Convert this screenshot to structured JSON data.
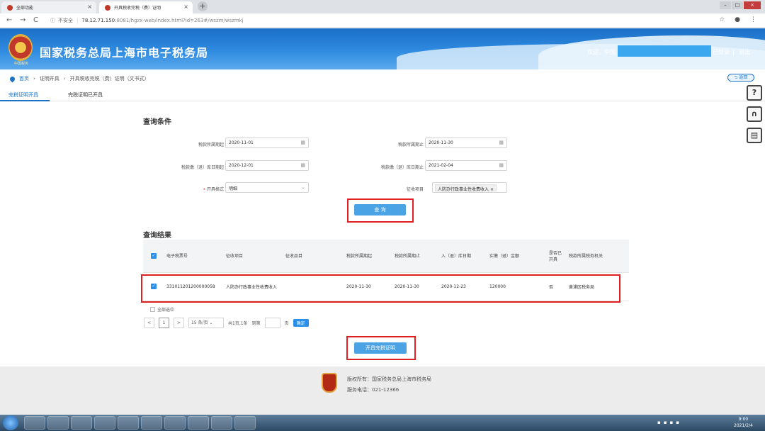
{
  "browser": {
    "tabs": [
      {
        "label": "全部功能",
        "close": "×"
      },
      {
        "label": "开具税收完税（费）证明",
        "close": "×"
      }
    ],
    "new_tab": "+",
    "not_secure": "不安全",
    "url_host": "78.12.71.150",
    "url_rest": ":8081/hgzx-web/index.html?id=263#/wszm/wszmkj",
    "star": "☆",
    "menu": "⋮"
  },
  "header": {
    "emblem_text": "中国税务",
    "site_title": "国家税务总局上海市电子税务局",
    "welcome": "欢迎，中国",
    "user_suffix": "已登录",
    "logout": "退出"
  },
  "breadcrumb": {
    "items": [
      "首页",
      "证明开具",
      "开具税收完税（费）证明（文书式）"
    ],
    "back": "返回"
  },
  "subtabs": [
    "完税证明开具",
    "完税证明已开具"
  ],
  "query": {
    "title": "查询条件",
    "fields": {
      "period_start_label": "税款所属期起",
      "period_start_value": "2020-11-01",
      "period_end_label": "税款所属期止",
      "period_end_value": "2020-11-30",
      "stock_start_label": "税款缴（退）库日期起",
      "stock_start_value": "2020-12-01",
      "stock_end_label": "税款缴（退）库日期止",
      "stock_end_value": "2021-02-04",
      "format_label": "开具格式",
      "format_value": "明细",
      "item_label": "征收项目",
      "item_value": "人防办行政事业性收费收入"
    },
    "button": "查 询"
  },
  "results": {
    "title": "查询结果",
    "headers": [
      "电子税票号",
      "征收项目",
      "征收品目",
      "税款所属期起",
      "税款所属期止",
      "入（退）库日期",
      "实缴（退）金额",
      "是否已开具",
      "税款所属税务机关"
    ],
    "rows": [
      {
        "ticket": "331011201200000058",
        "item": "人防办行政事业性收费收入",
        "subitem": "",
        "start": "2020-11-30",
        "end": "2020-11-30",
        "stock_date": "2020-12-23",
        "amount": "120000",
        "issued": "否",
        "office": "黄浦区税务局"
      }
    ],
    "select_all": "全部选中"
  },
  "pager": {
    "prev": "<",
    "current": "1",
    "next": ">",
    "page_size": "15 条/页",
    "summary": "共1页,1条",
    "goto": "到第",
    "page_unit": "页",
    "confirm": "确定"
  },
  "issue_button": "开具完税证明",
  "footer": {
    "copyright": "版权所有：国家税务总局上海市税务局",
    "phone": "服务电话：021-12366"
  },
  "taskbar": {
    "time": "9:00",
    "date": "2021/2/4"
  },
  "colors": {
    "brand_blue": "#1a73c7",
    "button_blue": "#4aa3e4",
    "highlight_red": "#e02020"
  }
}
